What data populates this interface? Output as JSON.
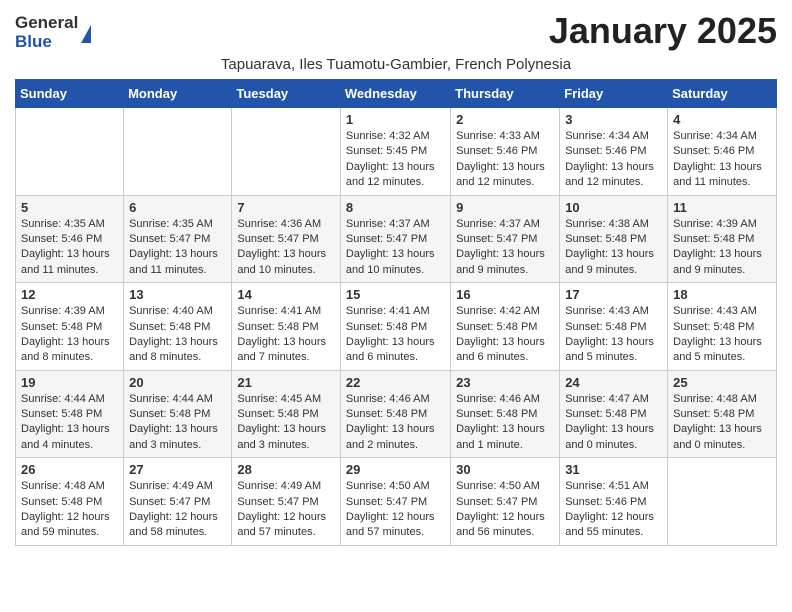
{
  "logo": {
    "general": "General",
    "blue": "Blue"
  },
  "title": "January 2025",
  "subtitle": "Tapuarava, Iles Tuamotu-Gambier, French Polynesia",
  "headers": [
    "Sunday",
    "Monday",
    "Tuesday",
    "Wednesday",
    "Thursday",
    "Friday",
    "Saturday"
  ],
  "weeks": [
    [
      {
        "day": "",
        "info": ""
      },
      {
        "day": "",
        "info": ""
      },
      {
        "day": "",
        "info": ""
      },
      {
        "day": "1",
        "info": "Sunrise: 4:32 AM\nSunset: 5:45 PM\nDaylight: 13 hours and 12 minutes."
      },
      {
        "day": "2",
        "info": "Sunrise: 4:33 AM\nSunset: 5:46 PM\nDaylight: 13 hours and 12 minutes."
      },
      {
        "day": "3",
        "info": "Sunrise: 4:34 AM\nSunset: 5:46 PM\nDaylight: 13 hours and 12 minutes."
      },
      {
        "day": "4",
        "info": "Sunrise: 4:34 AM\nSunset: 5:46 PM\nDaylight: 13 hours and 11 minutes."
      }
    ],
    [
      {
        "day": "5",
        "info": "Sunrise: 4:35 AM\nSunset: 5:46 PM\nDaylight: 13 hours and 11 minutes."
      },
      {
        "day": "6",
        "info": "Sunrise: 4:35 AM\nSunset: 5:47 PM\nDaylight: 13 hours and 11 minutes."
      },
      {
        "day": "7",
        "info": "Sunrise: 4:36 AM\nSunset: 5:47 PM\nDaylight: 13 hours and 10 minutes."
      },
      {
        "day": "8",
        "info": "Sunrise: 4:37 AM\nSunset: 5:47 PM\nDaylight: 13 hours and 10 minutes."
      },
      {
        "day": "9",
        "info": "Sunrise: 4:37 AM\nSunset: 5:47 PM\nDaylight: 13 hours and 9 minutes."
      },
      {
        "day": "10",
        "info": "Sunrise: 4:38 AM\nSunset: 5:48 PM\nDaylight: 13 hours and 9 minutes."
      },
      {
        "day": "11",
        "info": "Sunrise: 4:39 AM\nSunset: 5:48 PM\nDaylight: 13 hours and 9 minutes."
      }
    ],
    [
      {
        "day": "12",
        "info": "Sunrise: 4:39 AM\nSunset: 5:48 PM\nDaylight: 13 hours and 8 minutes."
      },
      {
        "day": "13",
        "info": "Sunrise: 4:40 AM\nSunset: 5:48 PM\nDaylight: 13 hours and 8 minutes."
      },
      {
        "day": "14",
        "info": "Sunrise: 4:41 AM\nSunset: 5:48 PM\nDaylight: 13 hours and 7 minutes."
      },
      {
        "day": "15",
        "info": "Sunrise: 4:41 AM\nSunset: 5:48 PM\nDaylight: 13 hours and 6 minutes."
      },
      {
        "day": "16",
        "info": "Sunrise: 4:42 AM\nSunset: 5:48 PM\nDaylight: 13 hours and 6 minutes."
      },
      {
        "day": "17",
        "info": "Sunrise: 4:43 AM\nSunset: 5:48 PM\nDaylight: 13 hours and 5 minutes."
      },
      {
        "day": "18",
        "info": "Sunrise: 4:43 AM\nSunset: 5:48 PM\nDaylight: 13 hours and 5 minutes."
      }
    ],
    [
      {
        "day": "19",
        "info": "Sunrise: 4:44 AM\nSunset: 5:48 PM\nDaylight: 13 hours and 4 minutes."
      },
      {
        "day": "20",
        "info": "Sunrise: 4:44 AM\nSunset: 5:48 PM\nDaylight: 13 hours and 3 minutes."
      },
      {
        "day": "21",
        "info": "Sunrise: 4:45 AM\nSunset: 5:48 PM\nDaylight: 13 hours and 3 minutes."
      },
      {
        "day": "22",
        "info": "Sunrise: 4:46 AM\nSunset: 5:48 PM\nDaylight: 13 hours and 2 minutes."
      },
      {
        "day": "23",
        "info": "Sunrise: 4:46 AM\nSunset: 5:48 PM\nDaylight: 13 hours and 1 minute."
      },
      {
        "day": "24",
        "info": "Sunrise: 4:47 AM\nSunset: 5:48 PM\nDaylight: 13 hours and 0 minutes."
      },
      {
        "day": "25",
        "info": "Sunrise: 4:48 AM\nSunset: 5:48 PM\nDaylight: 13 hours and 0 minutes."
      }
    ],
    [
      {
        "day": "26",
        "info": "Sunrise: 4:48 AM\nSunset: 5:48 PM\nDaylight: 12 hours and 59 minutes."
      },
      {
        "day": "27",
        "info": "Sunrise: 4:49 AM\nSunset: 5:47 PM\nDaylight: 12 hours and 58 minutes."
      },
      {
        "day": "28",
        "info": "Sunrise: 4:49 AM\nSunset: 5:47 PM\nDaylight: 12 hours and 57 minutes."
      },
      {
        "day": "29",
        "info": "Sunrise: 4:50 AM\nSunset: 5:47 PM\nDaylight: 12 hours and 57 minutes."
      },
      {
        "day": "30",
        "info": "Sunrise: 4:50 AM\nSunset: 5:47 PM\nDaylight: 12 hours and 56 minutes."
      },
      {
        "day": "31",
        "info": "Sunrise: 4:51 AM\nSunset: 5:46 PM\nDaylight: 12 hours and 55 minutes."
      },
      {
        "day": "",
        "info": ""
      }
    ]
  ]
}
